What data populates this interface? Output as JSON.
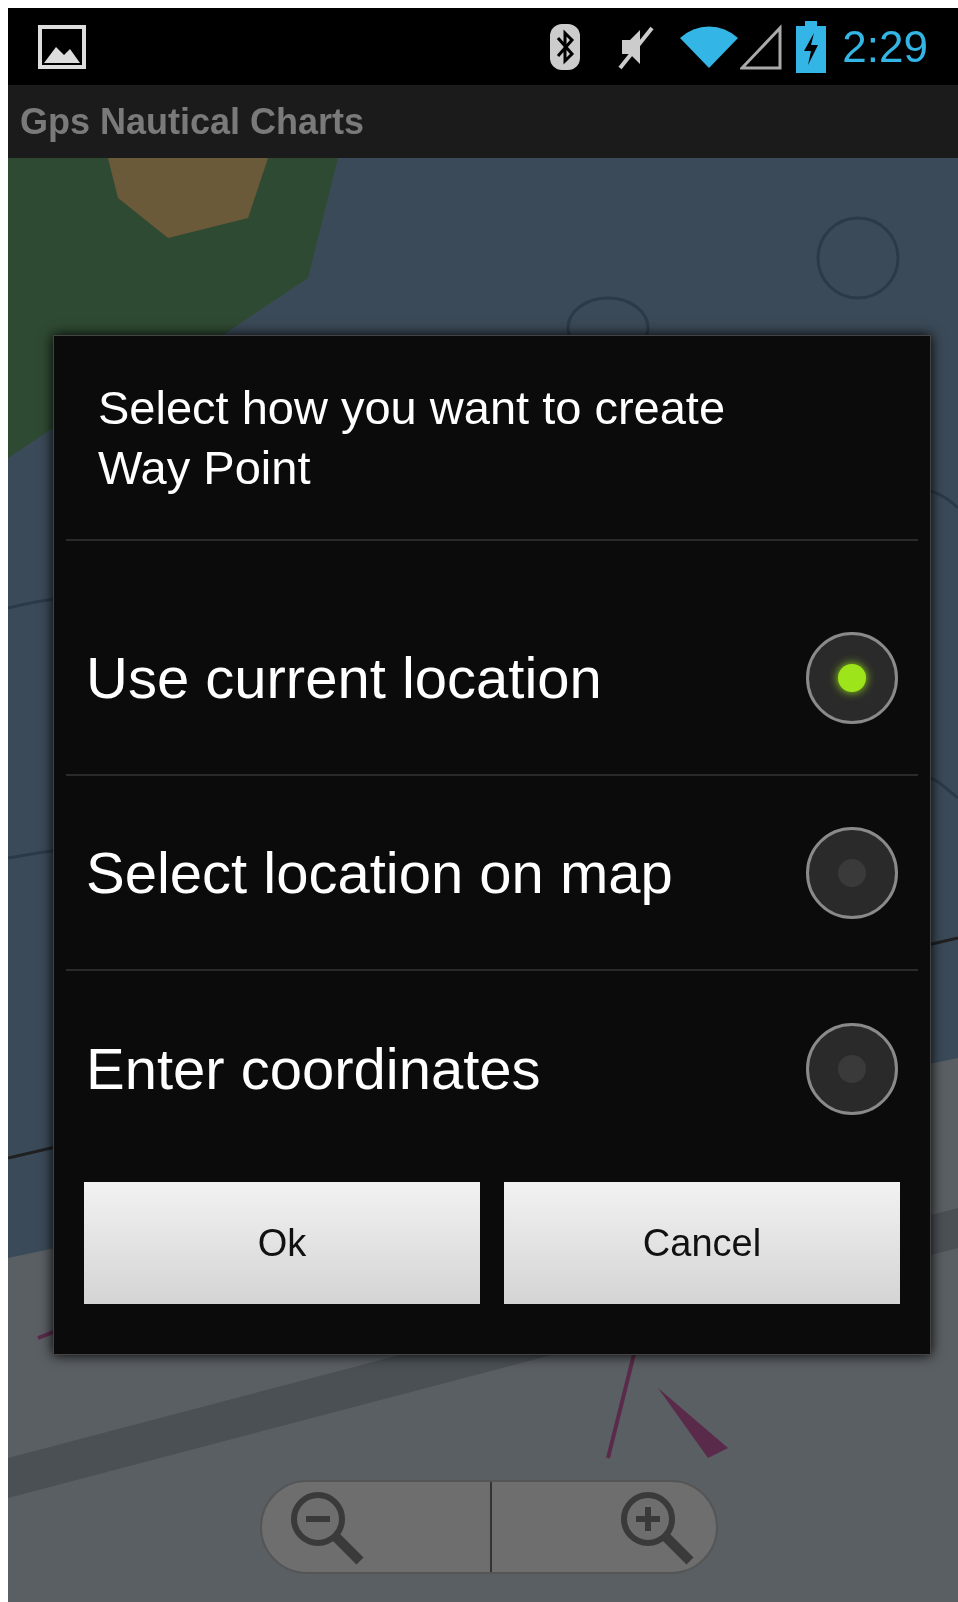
{
  "status_bar": {
    "time": "2:29"
  },
  "action_bar": {
    "title": "Gps Nautical Charts"
  },
  "dialog": {
    "title": "Select how you want to create Way Point",
    "options": [
      {
        "label": "Use current location",
        "selected": true
      },
      {
        "label": "Select location on map",
        "selected": false
      },
      {
        "label": "Enter coordinates",
        "selected": false
      }
    ],
    "buttons": [
      "Ok",
      "Cancel"
    ]
  }
}
